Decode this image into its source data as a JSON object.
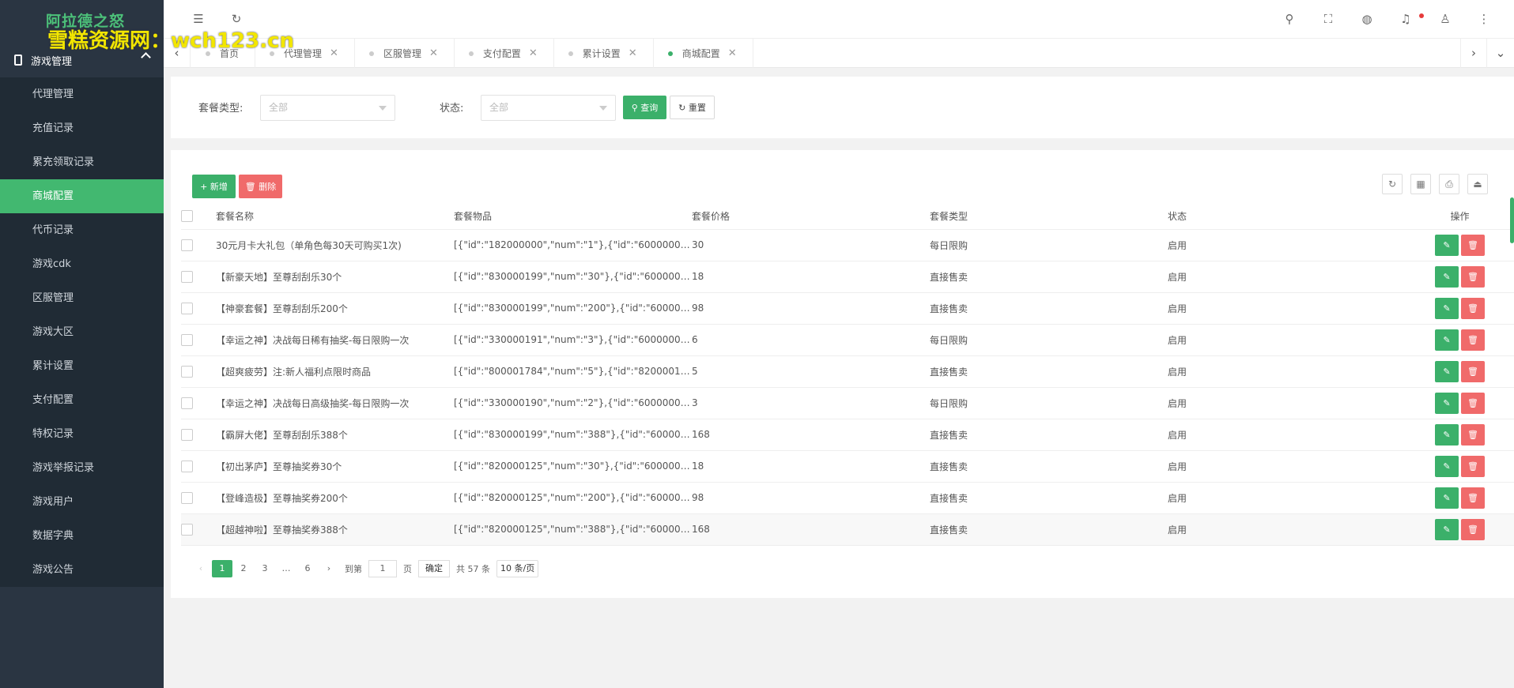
{
  "logo_text": "阿拉德之怒",
  "watermark": "雪糕资源网：wch123.cn",
  "sidebar": {
    "group_label": "游戏管理",
    "items": [
      {
        "label": "代理管理"
      },
      {
        "label": "充值记录"
      },
      {
        "label": "累充领取记录"
      },
      {
        "label": "商城配置",
        "active": true
      },
      {
        "label": "代币记录"
      },
      {
        "label": "游戏cdk"
      },
      {
        "label": "区服管理"
      },
      {
        "label": "游戏大区"
      },
      {
        "label": "累计设置"
      },
      {
        "label": "支付配置"
      },
      {
        "label": "特权记录"
      },
      {
        "label": "游戏举报记录"
      },
      {
        "label": "游戏用户"
      },
      {
        "label": "数据字典"
      },
      {
        "label": "游戏公告"
      }
    ]
  },
  "tabs": [
    {
      "label": "首页",
      "closable": false
    },
    {
      "label": "代理管理",
      "closable": true
    },
    {
      "label": "区服管理",
      "closable": true
    },
    {
      "label": "支付配置",
      "closable": true
    },
    {
      "label": "累计设置",
      "closable": true
    },
    {
      "label": "商城配置",
      "closable": true,
      "active": true
    }
  ],
  "filter": {
    "type_label": "套餐类型:",
    "type_value": "全部",
    "status_label": "状态:",
    "status_value": "全部",
    "query_label": "查询",
    "reset_label": "重置"
  },
  "toolbar": {
    "add_label": "新增",
    "delete_label": "删除"
  },
  "table": {
    "columns": [
      "套餐名称",
      "套餐物品",
      "套餐价格",
      "套餐类型",
      "状态",
      "操作"
    ],
    "rows": [
      [
        "30元月卡大礼包（单角色每30天可购买1次)",
        "[{\"id\":\"182000000\",\"num\":\"1\"},{\"id\":\"600000063…",
        "30",
        "每日限购",
        "启用"
      ],
      [
        "【新豪天地】至尊刮刮乐30个",
        "[{\"id\":\"830000199\",\"num\":\"30\"},{\"id\":\"60000006…",
        "18",
        "直接售卖",
        "启用"
      ],
      [
        "【神豪套餐】至尊刮刮乐200个",
        "[{\"id\":\"830000199\",\"num\":\"200\"},{\"id\":\"6000000…",
        "98",
        "直接售卖",
        "启用"
      ],
      [
        "【幸运之神】决战每日稀有抽奖-每日限购一次",
        "[{\"id\":\"330000191\",\"num\":\"3\"},{\"id\":\"600000063…",
        "6",
        "每日限购",
        "启用"
      ],
      [
        "【超爽疲劳】注:新人福利点限时商品",
        "[{\"id\":\"800001784\",\"num\":\"5\"},{\"id\":\"820000120…",
        "5",
        "直接售卖",
        "启用"
      ],
      [
        "【幸运之神】决战每日高级抽奖-每日限购一次",
        "[{\"id\":\"330000190\",\"num\":\"2\"},{\"id\":\"600000063…",
        "3",
        "每日限购",
        "启用"
      ],
      [
        "【霸屏大佬】至尊刮刮乐388个",
        "[{\"id\":\"830000199\",\"num\":\"388\"},{\"id\":\"6000000…",
        "168",
        "直接售卖",
        "启用"
      ],
      [
        "【初出茅庐】至尊抽奖券30个",
        "[{\"id\":\"820000125\",\"num\":\"30\"},{\"id\":\"60000006…",
        "18",
        "直接售卖",
        "启用"
      ],
      [
        "【登峰造极】至尊抽奖券200个",
        "[{\"id\":\"820000125\",\"num\":\"200\"},{\"id\":\"6000000…",
        "98",
        "直接售卖",
        "启用"
      ],
      [
        "【超越神啦】至尊抽奖券388个",
        "[{\"id\":\"820000125\",\"num\":\"388\"},{\"id\":\"6000000…",
        "168",
        "直接售卖",
        "启用"
      ]
    ]
  },
  "pager": {
    "pages": [
      "1",
      "2",
      "3",
      "…",
      "6"
    ],
    "goto_label": "到第",
    "goto_value": "1",
    "page_unit": "页",
    "confirm_label": "确定",
    "total_label": "共 57 条",
    "page_size": "10 条/页"
  },
  "colors": {
    "accent": "#3bb06a",
    "danger": "#f06a6a",
    "sidebar": "#2a3542",
    "notify_dot": "#e63b3b"
  }
}
